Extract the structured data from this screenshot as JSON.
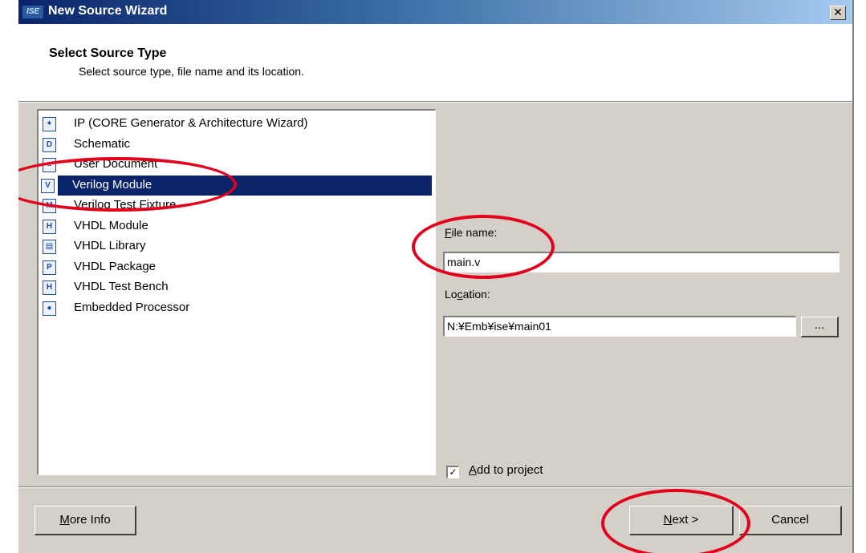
{
  "window": {
    "app_icon_text": "ISE",
    "title": "New Source Wizard",
    "close_icon": "close-icon",
    "close_glyph": "✕"
  },
  "header": {
    "title": "Select Source Type",
    "subtitle": "Select source type, file name and its location."
  },
  "source_list": {
    "items": [
      {
        "label": "IP (CORE Generator & Architecture Wizard)",
        "icon": "ip-core-icon",
        "glyph": "✦"
      },
      {
        "label": "Schematic",
        "icon": "schematic-icon",
        "glyph": "D"
      },
      {
        "label": "User Document",
        "icon": "user-document-icon",
        "glyph": "≡"
      },
      {
        "label": "Verilog Module",
        "icon": "verilog-module-icon",
        "glyph": "V",
        "selected": true
      },
      {
        "label": "Verilog Test Fixture",
        "icon": "verilog-test-fixture-icon",
        "glyph": "M"
      },
      {
        "label": "VHDL Module",
        "icon": "vhdl-module-icon",
        "glyph": "H"
      },
      {
        "label": "VHDL Library",
        "icon": "vhdl-library-icon",
        "glyph": "▤"
      },
      {
        "label": "VHDL Package",
        "icon": "vhdl-package-icon",
        "glyph": "P"
      },
      {
        "label": "VHDL Test Bench",
        "icon": "vhdl-test-bench-icon",
        "glyph": "H"
      },
      {
        "label": "Embedded Processor",
        "icon": "embedded-processor-icon",
        "glyph": "●"
      }
    ]
  },
  "form": {
    "file_name_label_mnemonic": "F",
    "file_name_label_rest": "ile name:",
    "file_name_value": "main.v",
    "location_label_pre": "Lo",
    "location_label_mnemonic": "c",
    "location_label_rest": "ation:",
    "location_value": "N:¥Emb¥ise¥main01",
    "browse_label": "...",
    "add_to_project_checked": true,
    "check_glyph": "✓",
    "add_to_project_mnemonic": "A",
    "add_to_project_rest": "dd to project"
  },
  "footer": {
    "more_info_mnemonic": "M",
    "more_info_rest": "ore Info",
    "next_mnemonic": "N",
    "next_rest": "ext >",
    "cancel_label": "Cancel"
  },
  "annotations": {
    "color": "#e3001b"
  }
}
